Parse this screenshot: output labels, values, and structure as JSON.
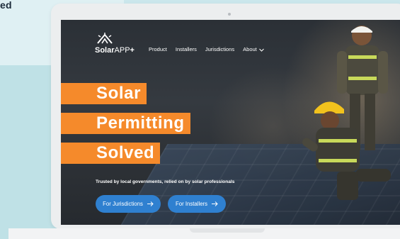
{
  "background": {
    "heading_fragment": "ed",
    "colors": {
      "page": "#bfe1e6",
      "panel": "#dff0f3"
    }
  },
  "site": {
    "logo": {
      "primary": "Solar",
      "secondary": "APP",
      "suffix": "+"
    },
    "nav": [
      {
        "label": "Product"
      },
      {
        "label": "Installers"
      },
      {
        "label": "Jurisdictions"
      },
      {
        "label": "About",
        "icon": "chevron-down-icon"
      }
    ],
    "hero": {
      "lines": [
        "Solar",
        "Permitting",
        "Solved"
      ],
      "accent_color": "#f58a2b"
    },
    "tagline": "Trusted by local governments, relied on by solar professionals",
    "buttons": [
      {
        "label": "For Jurisdictions",
        "icon": "arrow-right-icon"
      },
      {
        "label": "For Installers",
        "icon": "arrow-right-icon"
      }
    ],
    "button_color": "#2f80d0"
  }
}
